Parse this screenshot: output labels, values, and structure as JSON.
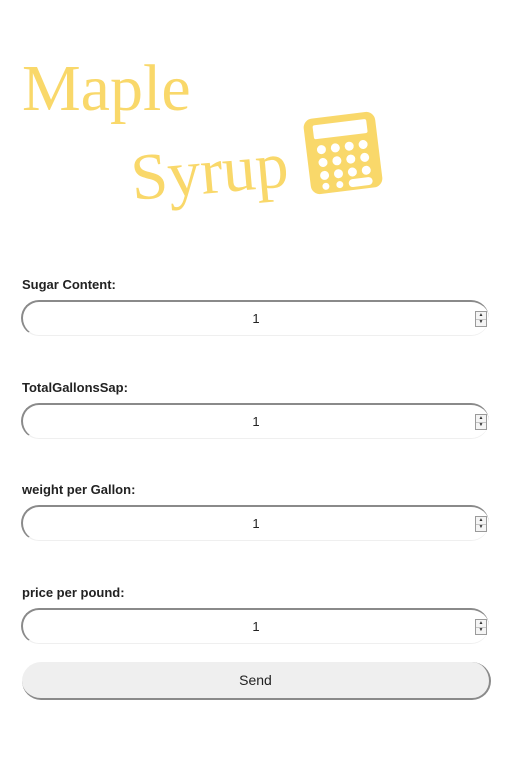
{
  "header": {
    "title_line1": "Maple",
    "title_line2": "Syrup",
    "icon": "calculator-icon",
    "accent_color": "#f9d86a"
  },
  "form": {
    "fields": [
      {
        "label": "Sugar Content:",
        "value": "1"
      },
      {
        "label": "TotalGallonsSap:",
        "value": "1"
      },
      {
        "label": "weight per Gallon:",
        "value": "1"
      },
      {
        "label": "price per pound:",
        "value": "1"
      }
    ],
    "submit_label": "Send"
  }
}
